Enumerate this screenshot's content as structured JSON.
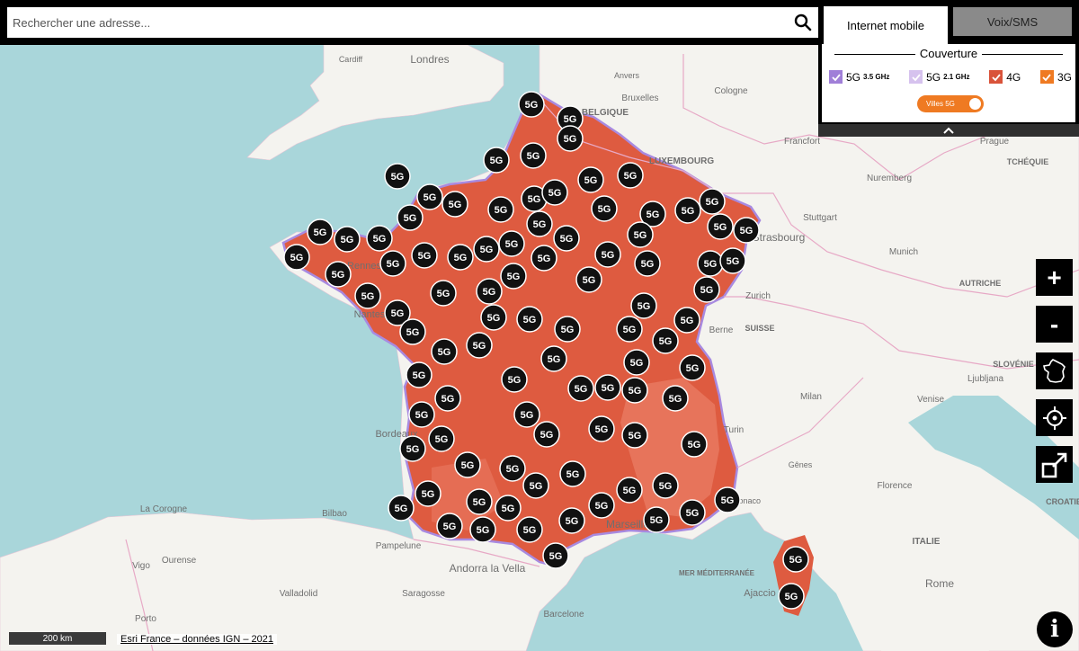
{
  "search": {
    "placeholder": "Rechercher une adresse..."
  },
  "tabs": {
    "active": "Internet mobile",
    "inactive": "Voix/SMS"
  },
  "legend": {
    "title": "Couverture",
    "items": [
      {
        "label": "5G",
        "sub": "3.5 GHz",
        "color": "#a07fd8",
        "checked": true
      },
      {
        "label": "5G",
        "sub": "2.1 GHz",
        "color": "#d6c2ee",
        "checked": true
      },
      {
        "label": "4G",
        "sub": "",
        "color": "#d9533a",
        "checked": true
      },
      {
        "label": "3G",
        "sub": "",
        "color": "#ef7a22",
        "checked": true
      }
    ]
  },
  "toggle": {
    "label": "Villes 5G",
    "on": true
  },
  "controls": {
    "zoom_in": "+",
    "zoom_out": "-",
    "info": "i"
  },
  "scale": "200 km",
  "attribution": "Esri France – données IGN – 2021",
  "badge_label": "5G",
  "map_labels": [
    "Londres",
    "Cardiff",
    "Anvers",
    "Bruxelles",
    "BELGIQUE",
    "Cologne",
    "Francfort",
    "Prague",
    "LUXEMBOURG",
    "TCHÉQUIE",
    "Nuremberg",
    "Stuttgart",
    "Strasbourg",
    "Munich",
    "AUTRICHE",
    "Zurich",
    "SUISSE",
    "SLOVÉNIE",
    "Ljubljana",
    "Berne",
    "Milan",
    "Venise",
    "Turin",
    "Gênes",
    "Florence",
    "CROATIE",
    "Monaco",
    "ITALIE",
    "MER MÉDITERRANÉE",
    "Ajaccio",
    "Rome",
    "Marseille",
    "Andorra la Vella",
    "Pampelune",
    "Bilbao",
    "La Corogne",
    "Vigo",
    "Ourense",
    "Valladolid",
    "Saragosse",
    "Porto",
    "Barcelone",
    "Rennes",
    "Nantes",
    "Bordeaux"
  ],
  "colors": {
    "coverage": "#de5b40",
    "coverage_5g": "#a88ae0",
    "sea": "#a9d6da",
    "land": "#f4f3ef",
    "accent": "#ef7a22"
  }
}
